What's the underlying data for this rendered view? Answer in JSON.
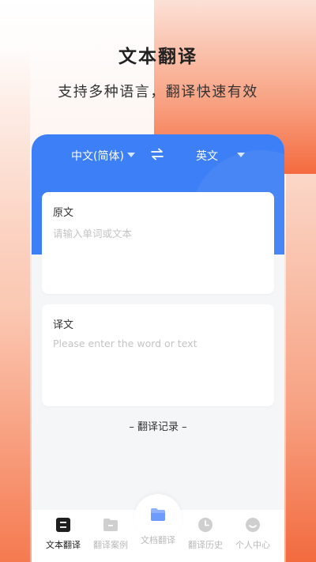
{
  "promo": {
    "title": "文本翻译",
    "subtitle": "支持多种语言，翻译快速有效"
  },
  "lang_bar": {
    "source_language": "中文(简体)",
    "target_language": "英文",
    "swap_icon": "swap-arrows-icon",
    "caret_icon": "caret-down-icon"
  },
  "source_card": {
    "title": "原文",
    "placeholder": "请输入单词或文本",
    "value": ""
  },
  "target_card": {
    "title": "译文",
    "placeholder": "Please enter the word or text",
    "value": ""
  },
  "history_link": "– 翻译记录 –",
  "tabs": [
    {
      "label": "文本翻译",
      "icon": "text-translate-icon",
      "active": true
    },
    {
      "label": "翻译案例",
      "icon": "folder-icon",
      "active": false
    },
    {
      "label": "文档翻译",
      "icon": "document-folder-icon",
      "active": false
    },
    {
      "label": "翻译历史",
      "icon": "clock-icon",
      "active": false
    },
    {
      "label": "个人中心",
      "icon": "smiley-icon",
      "active": false
    }
  ],
  "colors": {
    "brand_blue": "#3d7ff6",
    "accent_orange": "#f46a3e",
    "doc_icon_blue": "#8fb2ff"
  }
}
